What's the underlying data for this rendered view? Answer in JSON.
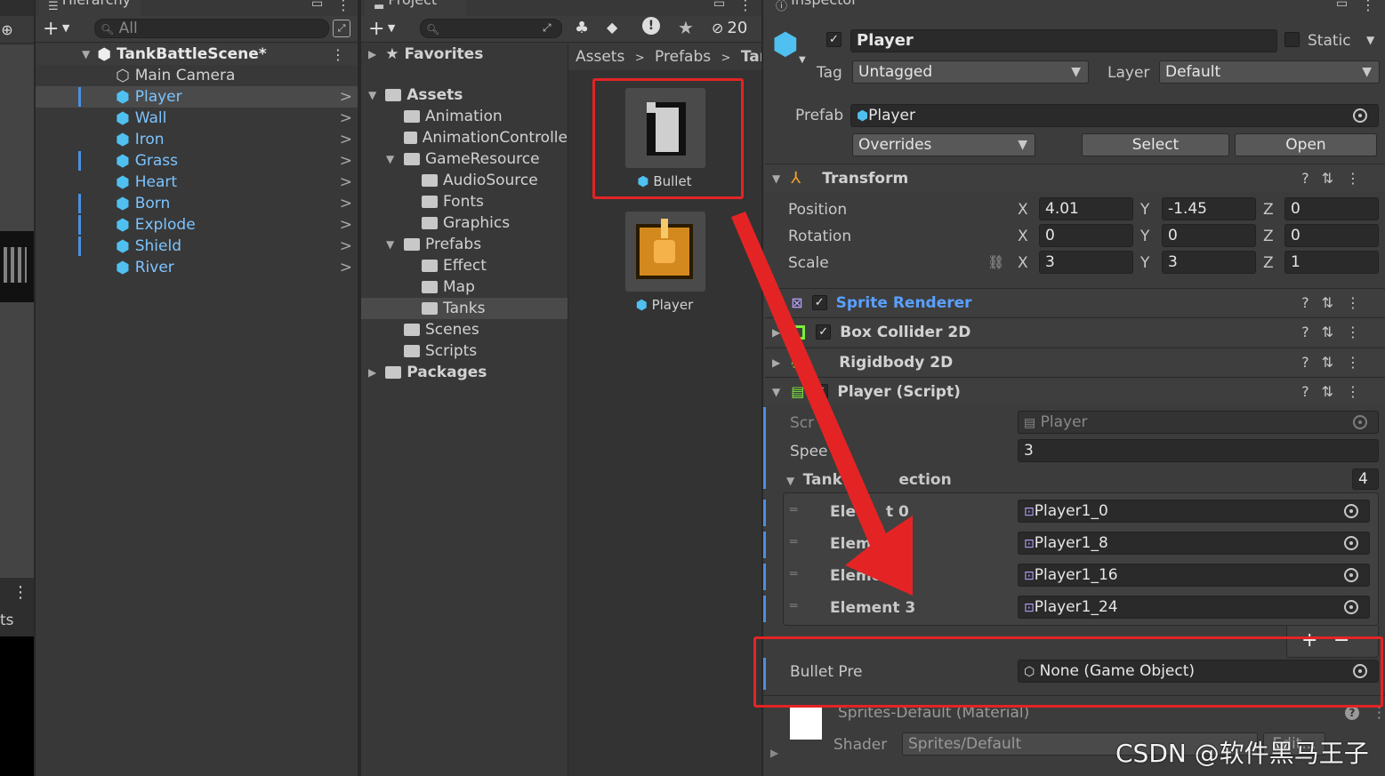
{
  "hierarchy": {
    "tab_label": "Hierarchy",
    "search_placeholder": "All",
    "scene_name": "TankBattleScene*",
    "items": [
      {
        "label": "Main Camera",
        "prefab": false
      },
      {
        "label": "Player",
        "prefab": true
      },
      {
        "label": "Wall",
        "prefab": true
      },
      {
        "label": "Iron",
        "prefab": true
      },
      {
        "label": "Grass",
        "prefab": true
      },
      {
        "label": "Heart",
        "prefab": true
      },
      {
        "label": "Born",
        "prefab": true
      },
      {
        "label": "Explode",
        "prefab": true
      },
      {
        "label": "Shield",
        "prefab": true
      },
      {
        "label": "River",
        "prefab": true
      }
    ]
  },
  "project": {
    "tab_label": "Project",
    "hidden_count": "20",
    "favorites": "Favorites",
    "assets": "Assets",
    "packages": "Packages",
    "tree": [
      {
        "label": "Animation",
        "depth": 1
      },
      {
        "label": "AnimationControlle",
        "depth": 1
      },
      {
        "label": "GameResource",
        "depth": 1
      },
      {
        "label": "AudioSource",
        "depth": 2
      },
      {
        "label": "Fonts",
        "depth": 2
      },
      {
        "label": "Graphics",
        "depth": 2
      },
      {
        "label": "Prefabs",
        "depth": 1
      },
      {
        "label": "Effect",
        "depth": 2
      },
      {
        "label": "Map",
        "depth": 2
      },
      {
        "label": "Tanks",
        "depth": 2
      },
      {
        "label": "Scenes",
        "depth": 1
      },
      {
        "label": "Scripts",
        "depth": 1
      }
    ],
    "breadcrumb": [
      "Assets",
      "Prefabs",
      "Tan"
    ],
    "grid_items": [
      {
        "label": "Bullet"
      },
      {
        "label": "Player"
      }
    ]
  },
  "inspector": {
    "tab_label": "Inspector",
    "object_name": "Player",
    "static_label": "Static",
    "tag_label": "Tag",
    "tag_value": "Untagged",
    "layer_label": "Layer",
    "layer_value": "Default",
    "prefab_label": "Prefab",
    "prefab_value": "Player",
    "overrides": "Overrides",
    "select_btn": "Select",
    "open_btn": "Open",
    "transform": {
      "title": "Transform",
      "position_label": "Position",
      "rotation_label": "Rotation",
      "scale_label": "Scale",
      "position": {
        "x": "4.01",
        "y": "-1.45",
        "z": "0"
      },
      "rotation": {
        "x": "0",
        "y": "0",
        "z": "0"
      },
      "scale": {
        "x": "3",
        "y": "3",
        "z": "1"
      }
    },
    "components": [
      "Sprite Renderer",
      "Box Collider 2D",
      "Rigidbody 2D",
      "Player (Script)"
    ],
    "script": {
      "script_label": "Scr",
      "script_value": "Player",
      "speed_label": "Spee",
      "speed_value": "3",
      "tank_label_a": "Tank",
      "tank_label_b": "ection",
      "tank_count": "4",
      "elements": [
        {
          "label_a": "Ele",
          "label_b": "t 0",
          "value": "Player1_0"
        },
        {
          "label_a": "Elem",
          "label_b": "",
          "value": "Player1_8"
        },
        {
          "label_a": "Elemen",
          "label_b": "",
          "value": "Player1_16"
        },
        {
          "label_a": "Element 3",
          "label_b": "",
          "value": "Player1_24"
        }
      ],
      "bullet_label": "Bullet Pre",
      "bullet_value": "None (Game Object)"
    },
    "material": {
      "name": "Sprites-Default (Material)",
      "shader_label": "Shader",
      "shader_value": "Sprites/Default",
      "edit": "Edit..."
    }
  },
  "left_strip": {
    "tab_fragment": "ts"
  },
  "watermark": "CSDN @软件黑马王子",
  "colors": {
    "accent_blue": "#5aa0ff",
    "red_annotation": "#e42424",
    "prefab_cube": "#4fc0ef"
  }
}
